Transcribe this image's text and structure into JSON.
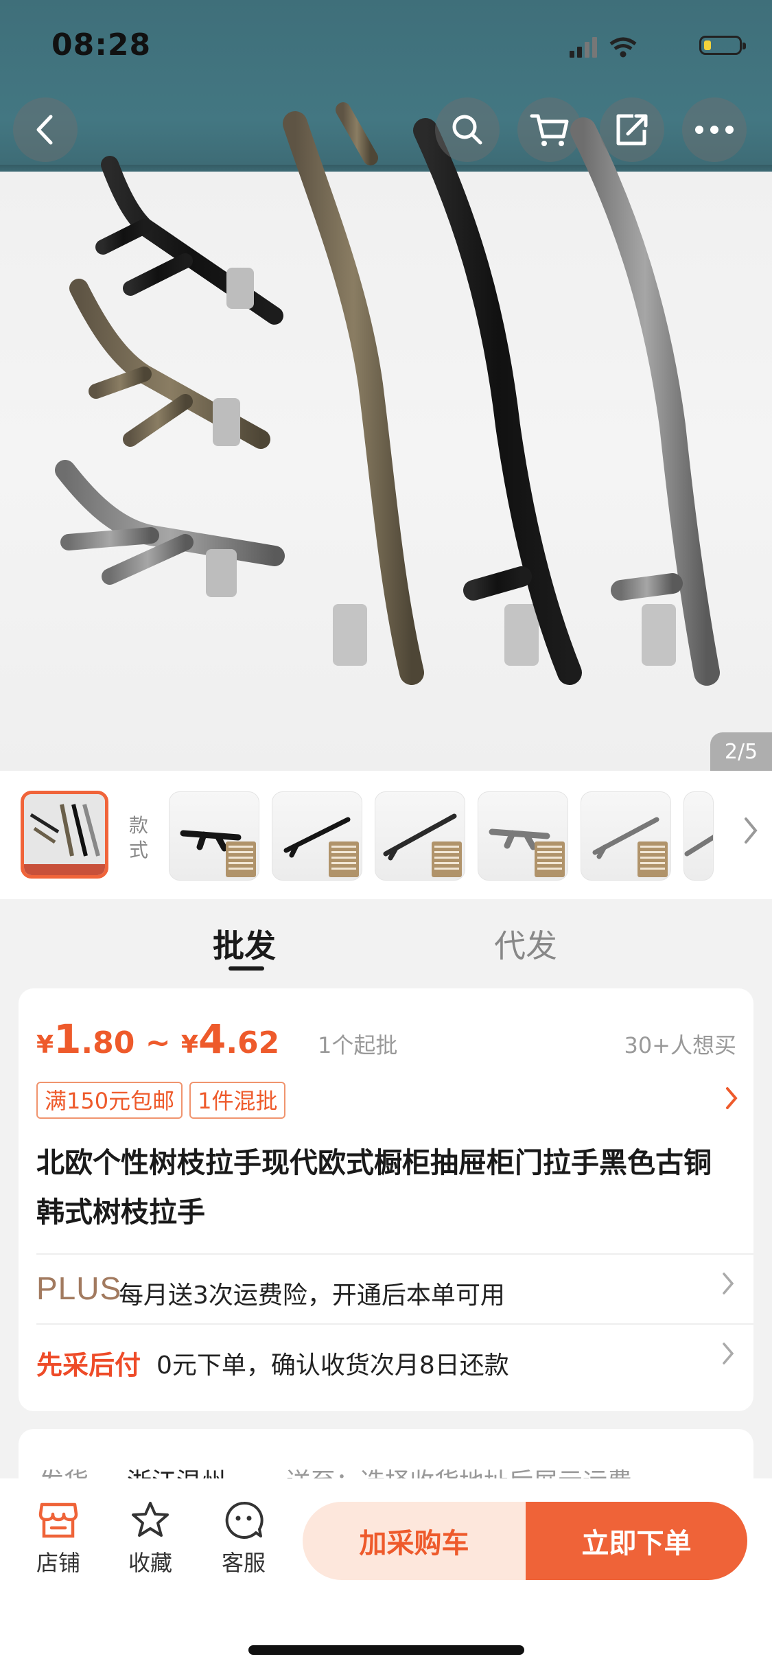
{
  "status_bar": {
    "time": "08:28"
  },
  "hero": {
    "counter": "2/5"
  },
  "variants": {
    "label": "款式",
    "thumbs": [
      "variant-1",
      "variant-2",
      "variant-3",
      "variant-4",
      "variant-5",
      "variant-6"
    ]
  },
  "tabs": {
    "wholesale": "批发",
    "dropship": "代发"
  },
  "price": {
    "cur1": "¥",
    "low_int": "1",
    "low_dec": ".80",
    "sep": " ~ ",
    "cur2": "¥",
    "high_int": "4",
    "high_dec": ".62",
    "min_order": "1个起批",
    "wants": "30+人想买"
  },
  "tags": [
    "满150元包邮",
    "1件混批"
  ],
  "product_title": "北欧个性树枝拉手现代欧式橱柜抽屉柜门拉手黑色古铜韩式树枝拉手",
  "plus": {
    "logo": "PLUS",
    "text": "每月送3次运费险，开通后本单可用"
  },
  "pay_later": {
    "label": "先采后付",
    "text": "0元下单，确认收货次月8日还款"
  },
  "shipping": {
    "from_label": "发货",
    "from_value": "浙江温州",
    "to_text": "送至：选择收货地址后展示运费"
  },
  "bottom_bar": {
    "store": "店铺",
    "favorite": "收藏",
    "service": "客服",
    "add_cart": "加采购车",
    "buy_now": "立即下单"
  },
  "colors": {
    "accent": "#ef6338",
    "price": "#ee5a2b",
    "plus": "#a27a5f"
  }
}
